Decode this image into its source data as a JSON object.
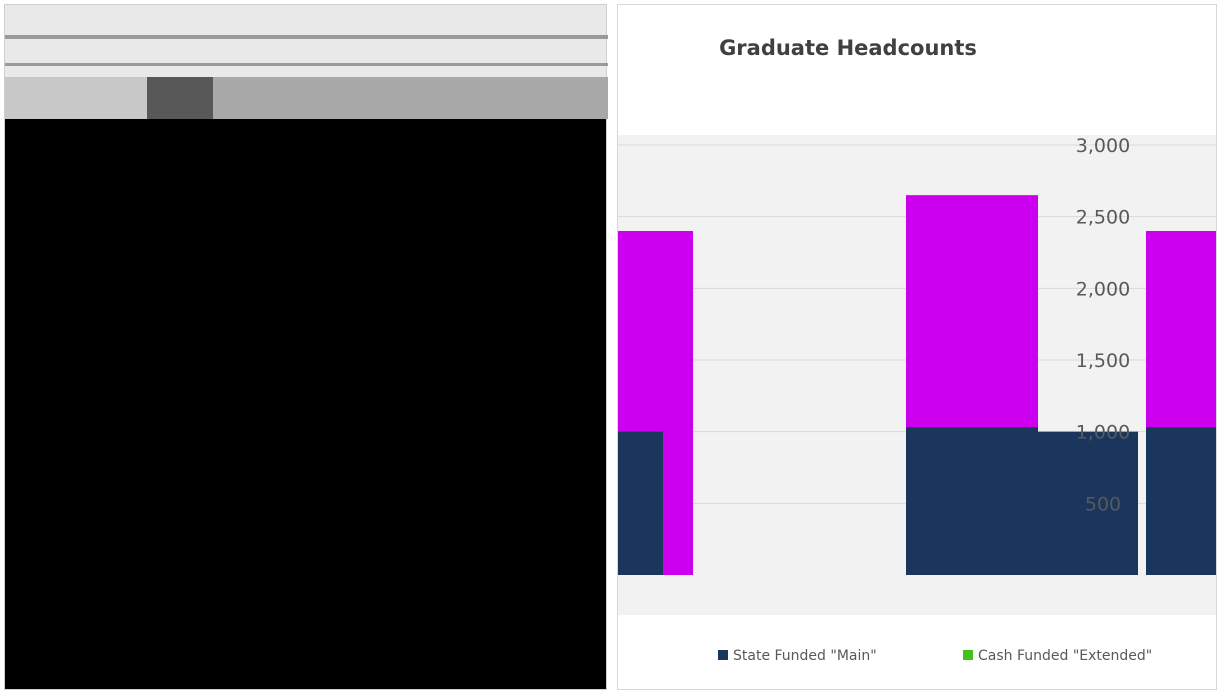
{
  "colors": {
    "state_funded": "#1b365d",
    "cash_funded": "#44c21b",
    "magenta_series": "#cc00ee",
    "gridline": "#d9d9d9",
    "plot_background": "#f2f2f2"
  },
  "chart_data": {
    "type": "bar",
    "title": "Graduate Headcounts",
    "ylim": [
      0,
      3000
    ],
    "yticks": [
      "500",
      "1,000",
      "1,500",
      "2,000",
      "2,500",
      "3,000"
    ],
    "grid": true,
    "legend_position": "bottom",
    "series": [
      {
        "name": "State Funded \"Main\"",
        "color": "#1b365d",
        "values": [
          1000,
          1030,
          1000,
          1030
        ]
      },
      {
        "name": "Cash Funded \"Extended\"",
        "color": "#44c21b",
        "values": []
      },
      {
        "color": "#cc00ee",
        "values": [
          2400,
          2650,
          2400
        ]
      }
    ]
  }
}
